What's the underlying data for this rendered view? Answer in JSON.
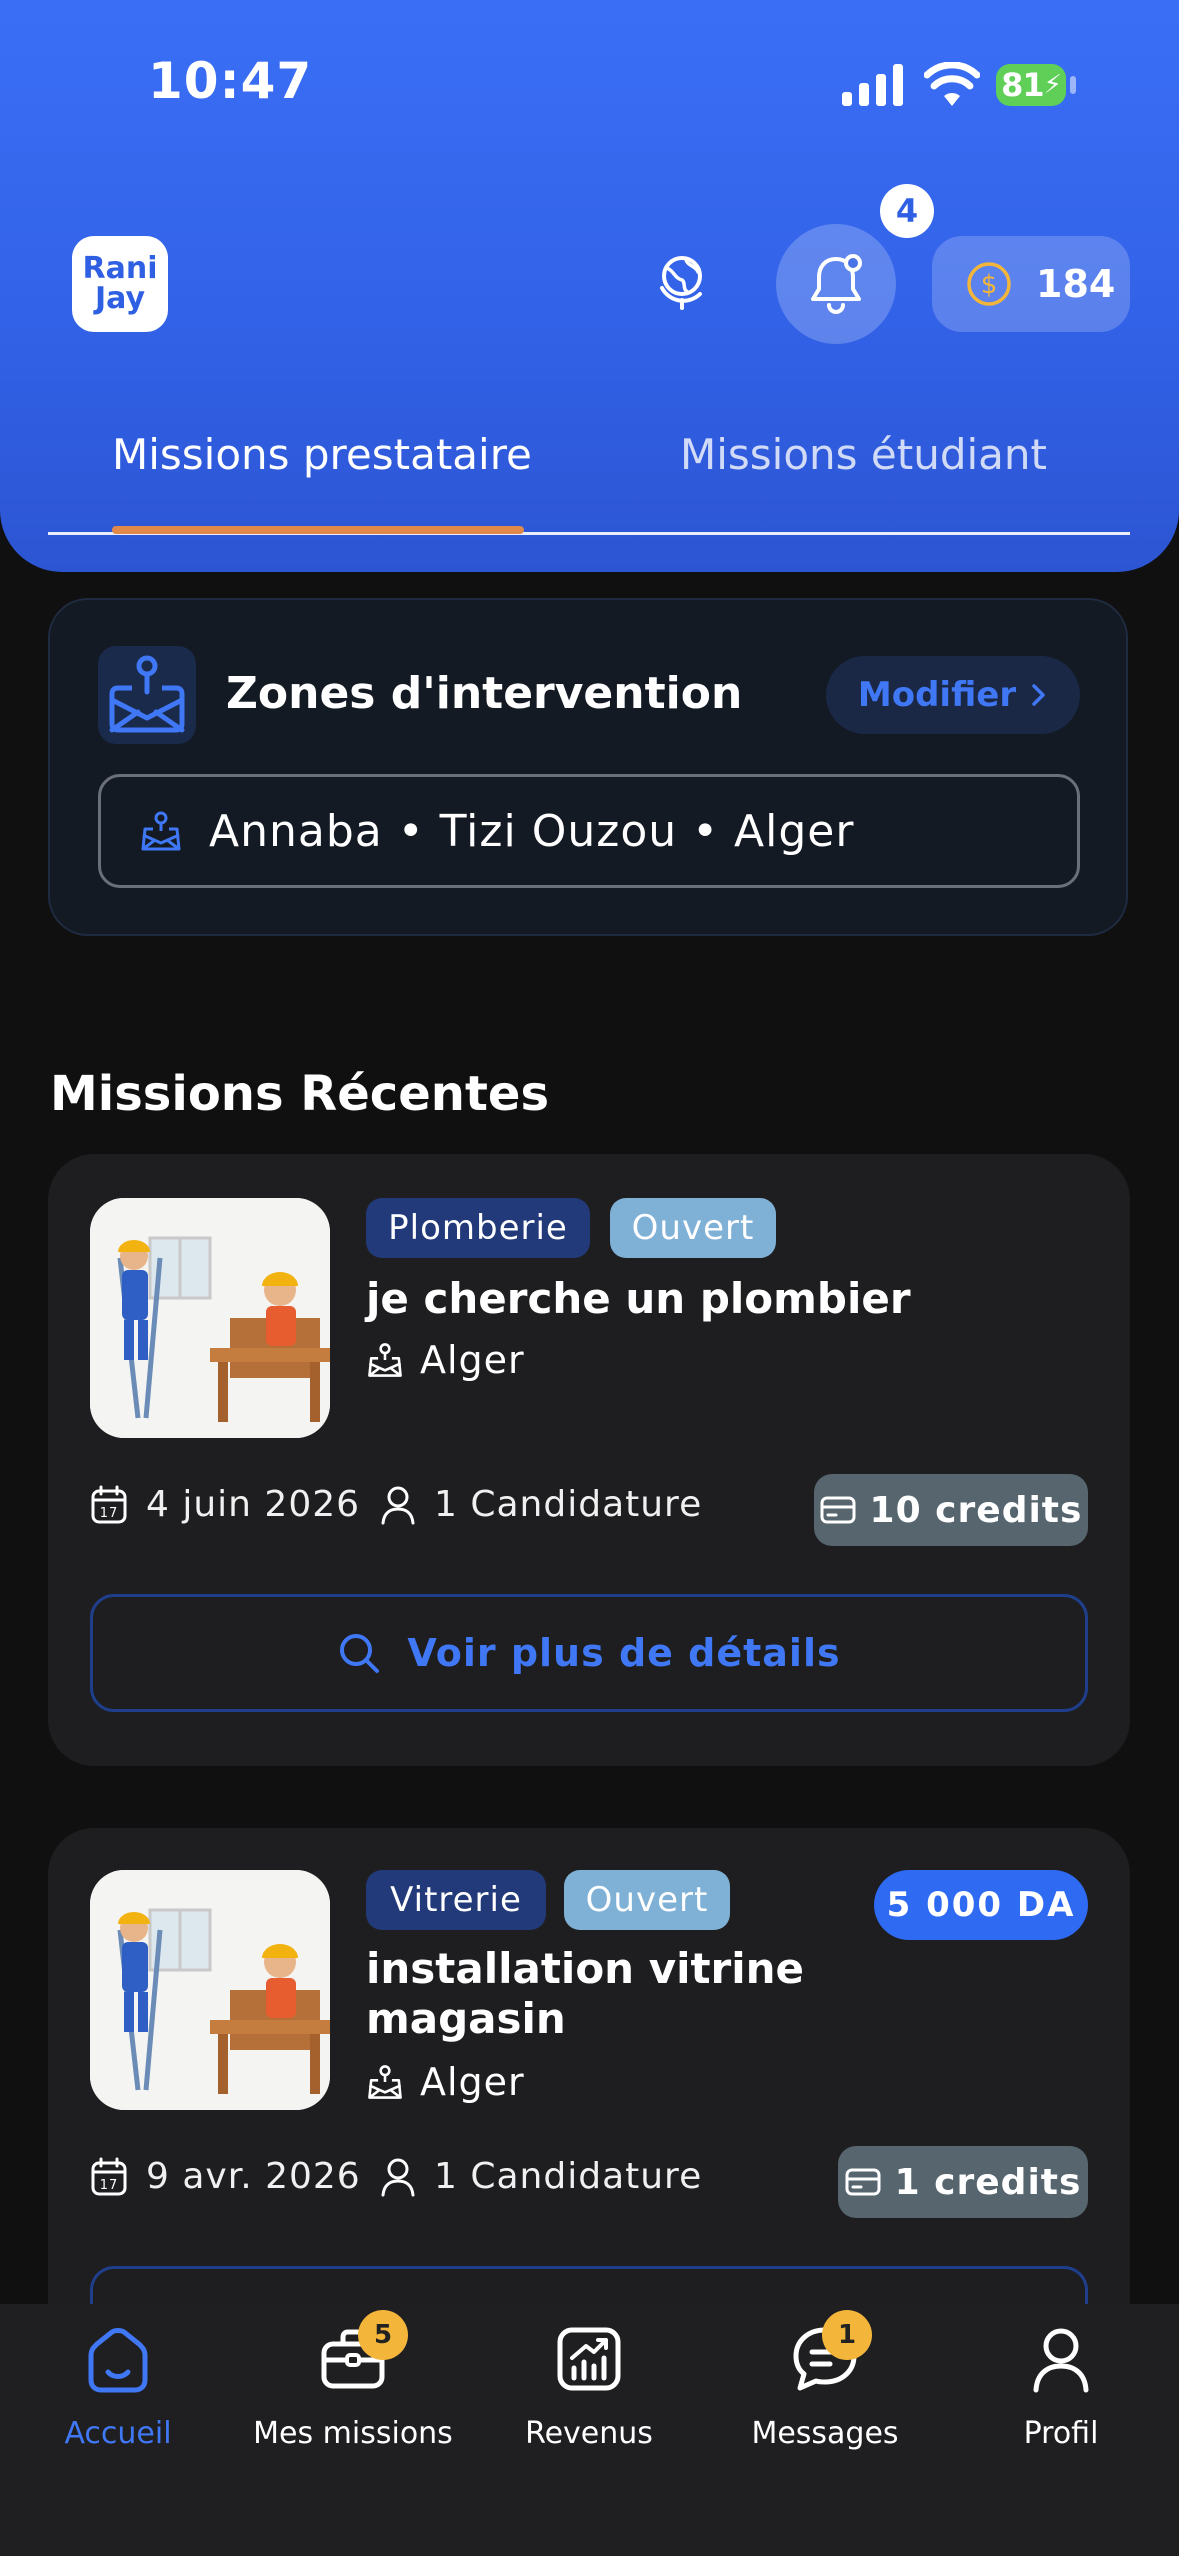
{
  "status_bar": {
    "time": "10:47",
    "battery": "81"
  },
  "header": {
    "logo_line1": "Rani",
    "logo_line2": "Jay",
    "notifications_count": "4",
    "credits_balance": "184",
    "tabs": [
      {
        "label": "Missions prestataire",
        "active": true
      },
      {
        "label": "Missions étudiant",
        "active": false
      }
    ]
  },
  "zones": {
    "title": "Zones d'intervention",
    "modify_label": "Modifier",
    "list": "Annaba • Tizi Ouzou • Alger"
  },
  "recent": {
    "title": "Missions Récentes",
    "missions": [
      {
        "category": "Plomberie",
        "status": "Ouvert",
        "title": "je cherche un plombier",
        "location": "Alger",
        "date": "4 juin 2026",
        "applications": "1 Candidature",
        "credits": "10 credits",
        "details_label": "Voir plus de détails"
      },
      {
        "category": "Vitrerie",
        "status": "Ouvert",
        "title_line1": "installation vitrine",
        "title_line2": "magasin",
        "location": "Alger",
        "price": "5 000 DA",
        "date": "9 avr. 2026",
        "applications": "1 Candidature",
        "credits": "1 credits"
      }
    ]
  },
  "bottom_nav": [
    {
      "label": "Accueil",
      "active": true
    },
    {
      "label": "Mes missions",
      "badge": "5"
    },
    {
      "label": "Revenus"
    },
    {
      "label": "Messages",
      "badge": "1"
    },
    {
      "label": "Profil"
    }
  ],
  "colors": {
    "accent": "#3F77F5",
    "header": "#3262E8",
    "tab_indicator": "#E0894A",
    "badge": "#F3B63B"
  }
}
